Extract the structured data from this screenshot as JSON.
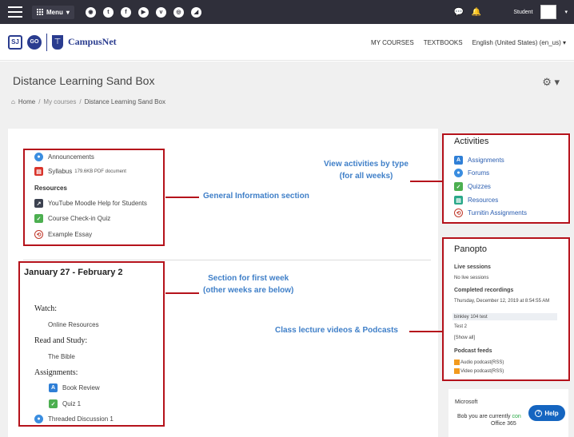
{
  "topbar": {
    "menu_label": "Menu",
    "social_icons": [
      "globe-icon",
      "twitter-icon",
      "facebook-icon",
      "youtube-icon",
      "vimeo-icon",
      "instagram-icon",
      "rss-icon"
    ],
    "social_glyphs": [
      "◉",
      "t",
      "f",
      "▶",
      "v",
      "◎",
      "◢"
    ],
    "chat_glyph": "💬",
    "bell_glyph": "🔔",
    "user_name": "Student",
    "caret": "▾"
  },
  "brand": {
    "sj": "SJ",
    "go": "GO",
    "shield": "⊤",
    "name": "CampusNet",
    "links": [
      "MY COURSES",
      "TEXTBOOKS",
      "English (United States) (en_us) ▾"
    ]
  },
  "header": {
    "title": "Distance Learning Sand Box",
    "gear": "⚙ ▾",
    "breadcrumb": {
      "home_glyph": "⌂",
      "home": "Home",
      "sep": "/",
      "my_courses": "My courses",
      "current": "Distance Learning Sand Box"
    }
  },
  "general": {
    "announcements": "Announcements",
    "syllabus": "Syllabus",
    "syllabus_meta": "179.6KB PDF document",
    "resources_head": "Resources",
    "youtube": "YouTube Moodle Help for Students",
    "checkin": "Course Check-in Quiz",
    "essay": "Example Essay"
  },
  "week": {
    "title": "January 27 - February 2",
    "watch_head": "Watch:",
    "online_resources": "Online Resources",
    "read_head": "Read and Study:",
    "bible": "The Bible",
    "assign_head": "Assignments:",
    "book_review": "Book Review",
    "quiz1": "Quiz 1",
    "discussion": "Threaded Discussion 1"
  },
  "annotations": {
    "general": "General Information section",
    "week": [
      "Section for first week",
      "(other weeks are below)"
    ],
    "activities": [
      "View activities by type",
      "(for all weeks)"
    ],
    "lectures": "Class lecture videos & Podcasts"
  },
  "activities": {
    "title": "Activities",
    "items": [
      "Assignments",
      "Forums",
      "Quizzes",
      "Resources",
      "Turnitin Assignments"
    ]
  },
  "panopto": {
    "title": "Panopto",
    "live_head": "Live sessions",
    "live_none": "No live sessions",
    "completed_head": "Completed recordings",
    "rec_date": "Thursday, December 12, 2019 at 8:54:55 AM",
    "rec1": "binkley 104 test",
    "rec2": "Test 2",
    "show_all": "[Show all]",
    "feeds_head": "Podcast feeds",
    "audio": "Audio podcast",
    "video": "Video podcast",
    "rss_tag": "(RSS)"
  },
  "microsoft": {
    "title": "Microsoft",
    "line1_a": "Bob you are currently ",
    "line1_b": "con",
    "line2": "Office 365"
  },
  "help": {
    "q": "?",
    "label": "Help"
  }
}
